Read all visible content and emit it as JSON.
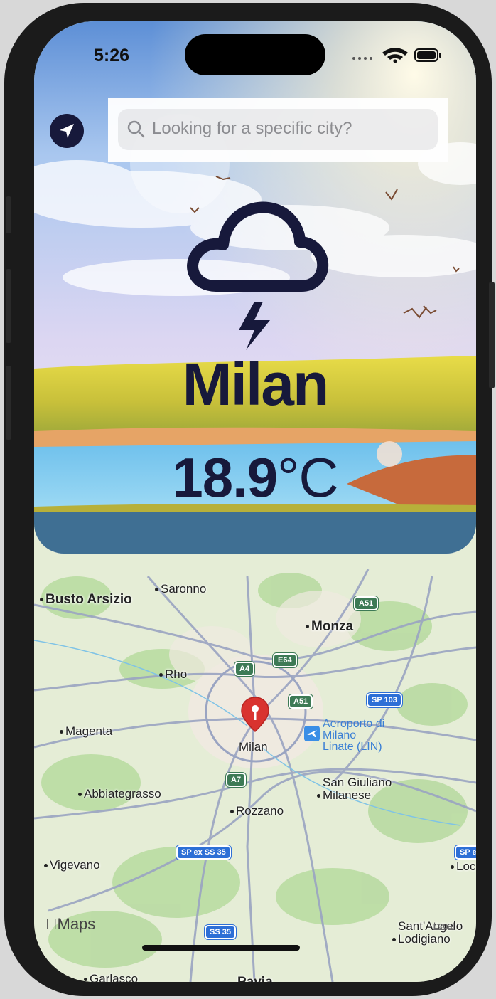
{
  "status": {
    "time": "5:26"
  },
  "search": {
    "placeholder": "Looking for a specific city?"
  },
  "weather": {
    "city": "Milan",
    "temperature": "18.9",
    "unit": "°C",
    "condition_icon": "cloud-lightning-icon"
  },
  "map": {
    "labels": [
      {
        "text": "Busto Arsizio",
        "big": true
      },
      {
        "text": "Saronno",
        "big": false
      },
      {
        "text": "Monza",
        "big": true
      },
      {
        "text": "Rho",
        "big": false
      },
      {
        "text": "Magenta",
        "big": false
      },
      {
        "text": "Milan",
        "big": false
      },
      {
        "text": "Abbiategrasso",
        "big": false
      },
      {
        "text": "Rozzano",
        "big": false
      },
      {
        "text": "San Giuliano",
        "big": false
      },
      {
        "text": "Milanese",
        "big": false
      },
      {
        "text": "Vigevano",
        "big": false
      },
      {
        "text": "Sant'Angelo",
        "big": false
      },
      {
        "text": "Lodigiano",
        "big": false
      },
      {
        "text": "Garlasco",
        "big": false
      },
      {
        "text": "Pavia",
        "big": true
      },
      {
        "text": "Loc",
        "big": false
      }
    ],
    "roads": [
      "A51",
      "A4",
      "E64",
      "A51",
      "SP 103",
      "A7",
      "SP ex SS 35",
      "SS 35",
      "SP ex"
    ],
    "airport": [
      "Aeroporto di",
      "Milano",
      "Linate (LIN)"
    ],
    "brand": "Maps",
    "legal": "Legal"
  }
}
